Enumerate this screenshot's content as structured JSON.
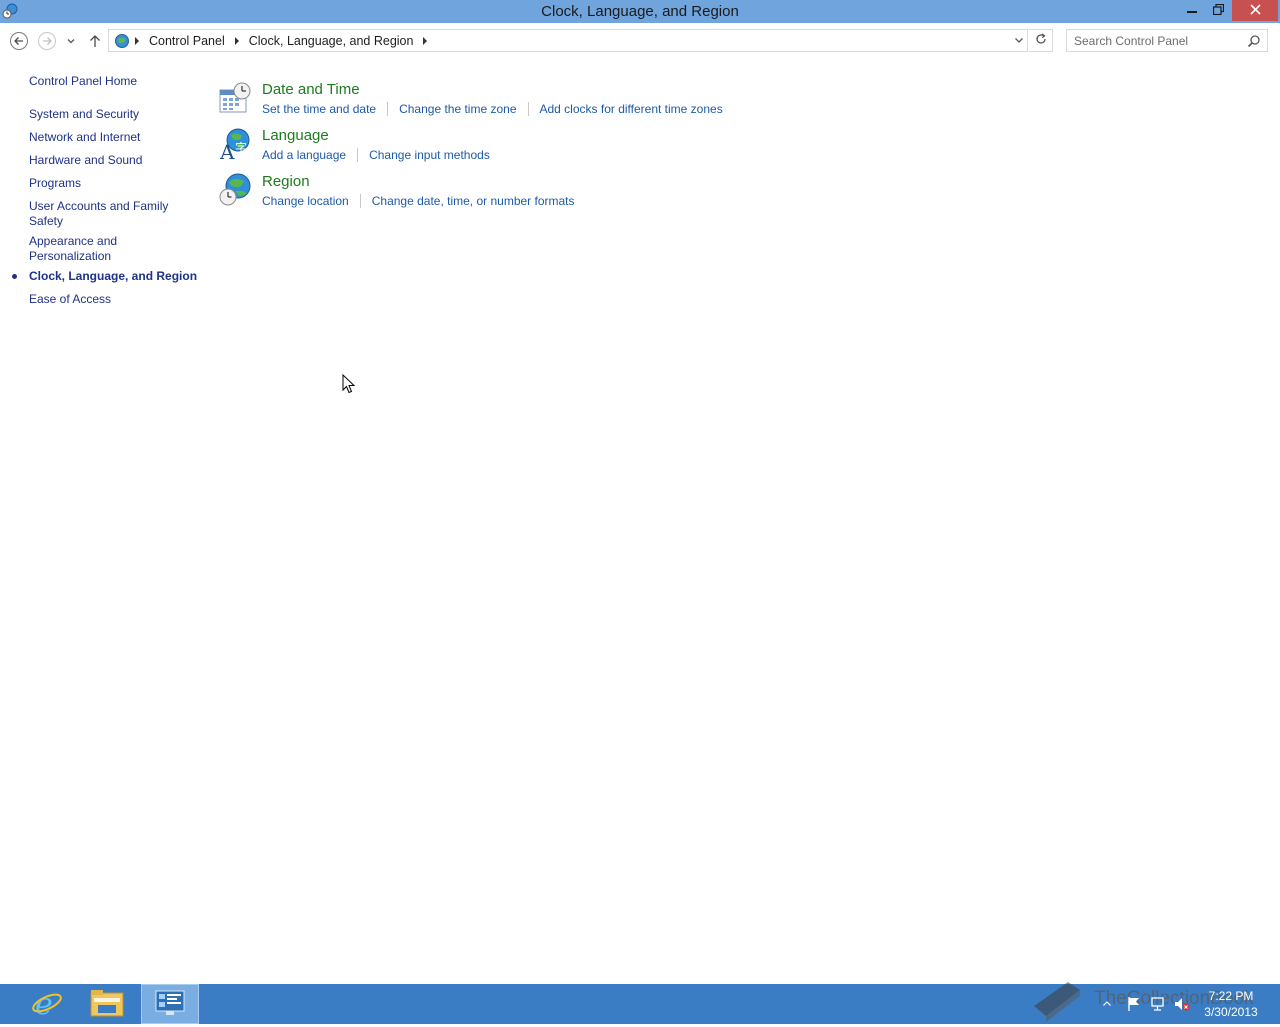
{
  "window": {
    "title": "Clock, Language, and Region",
    "icons": {
      "app": "control-panel-icon",
      "minimize": "minimize-icon",
      "maximize": "restore-icon",
      "close": "close-icon"
    }
  },
  "toolbar": {
    "back_icon": "back-arrow-icon",
    "forward_icon": "forward-arrow-icon",
    "recent_icon": "chevron-down-icon",
    "up_icon": "up-arrow-icon",
    "breadcrumbs": [
      "Control Panel",
      "Clock, Language, and Region"
    ],
    "refresh_icon": "refresh-icon",
    "search_placeholder": "Search Control Panel",
    "search_icon": "search-icon"
  },
  "sidebar": {
    "home": "Control Panel Home",
    "items": [
      {
        "label": "System and Security"
      },
      {
        "label": "Network and Internet"
      },
      {
        "label": "Hardware and Sound"
      },
      {
        "label": "Programs"
      },
      {
        "label": "User Accounts and Family Safety"
      },
      {
        "label": "Appearance and Personalization"
      },
      {
        "label": "Clock, Language, and Region",
        "current": true
      },
      {
        "label": "Ease of Access"
      }
    ]
  },
  "categories": [
    {
      "title": "Date and Time",
      "icon": "calendar-clock-icon",
      "links": [
        "Set the time and date",
        "Change the time zone",
        "Add clocks for different time zones"
      ]
    },
    {
      "title": "Language",
      "icon": "language-globe-icon",
      "links": [
        "Add a language",
        "Change input methods"
      ]
    },
    {
      "title": "Region",
      "icon": "region-globe-clock-icon",
      "links": [
        "Change location",
        "Change date, time, or number formats"
      ]
    }
  ],
  "taskbar": {
    "apps": [
      {
        "name": "Internet Explorer",
        "icon": "internet-explorer-icon"
      },
      {
        "name": "File Explorer",
        "icon": "file-explorer-icon"
      },
      {
        "name": "Control Panel",
        "icon": "control-panel-icon",
        "active": true
      }
    ],
    "tray_icons": [
      "show-hidden-icons-icon",
      "action-center-flag-icon",
      "network-icon",
      "volume-muted-icon"
    ],
    "time": "7:22 PM",
    "date": "3/30/2013"
  },
  "watermark": {
    "text": "TheCollectionBook"
  },
  "colors": {
    "titlebar": "#6fa4dd",
    "taskbar": "#3b7dc4",
    "category_title": "#1e7b1e",
    "link": "#1e5aa8",
    "nav_link": "#1e3287",
    "close_button": "#c75050"
  }
}
